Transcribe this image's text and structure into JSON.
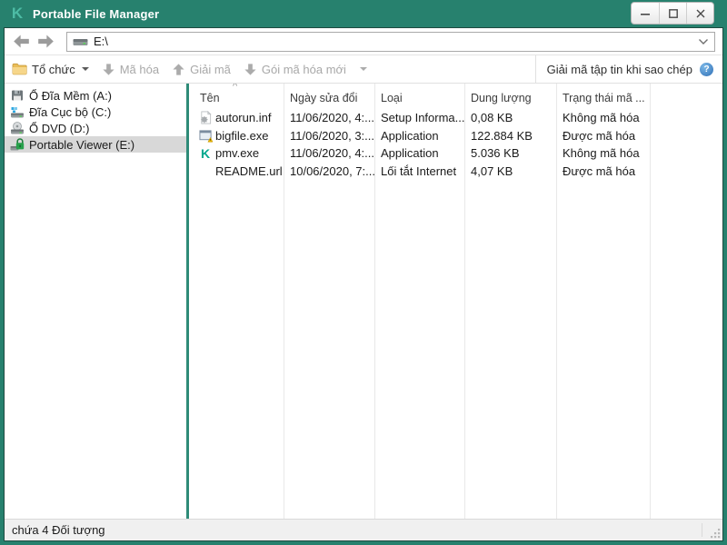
{
  "colors": {
    "titlebar_teal": "#27816E",
    "kaspersky_green": "#00A88E",
    "selection_gray": "#D8D8D8",
    "help_blue": "#3E86CC",
    "disabled_text": "#A8A8A8"
  },
  "window": {
    "title": "Portable File Manager"
  },
  "nav": {
    "address": "E:\\"
  },
  "toolbar": {
    "organize_label": "Tổ chức",
    "encrypt_label": "Mã hóa",
    "decrypt_label": "Giải mã",
    "new_package_label": "Gói mã hóa mới",
    "decrypt_on_copy_label": "Giải mã tập tin khi sao chép"
  },
  "sidebar": {
    "items": [
      {
        "label": "Ổ Đĩa Mềm (A:)",
        "icon": "floppy-drive-icon",
        "selected": false
      },
      {
        "label": "Đĩa Cục bộ (C:)",
        "icon": "local-disk-icon",
        "selected": false
      },
      {
        "label": "Ổ DVD (D:)",
        "icon": "dvd-drive-icon",
        "selected": false
      },
      {
        "label": "Portable Viewer (E:)",
        "icon": "locked-drive-icon",
        "selected": true
      }
    ]
  },
  "filelist": {
    "columns": [
      "Tên",
      "Ngày sửa đổi",
      "Loại",
      "Dung lượng",
      "Trạng thái mã ..."
    ],
    "rows": [
      {
        "name": "autorun.inf",
        "modified": "11/06/2020, 4:...",
        "type": "Setup Informa...",
        "size": "0,08 KB",
        "status": "Không mã hóa",
        "icon": "inf-file-icon"
      },
      {
        "name": "bigfile.exe",
        "modified": "11/06/2020, 3:...",
        "type": "Application",
        "size": "122.884 KB",
        "status": "Được mã hóa",
        "icon": "exe-file-icon"
      },
      {
        "name": "pmv.exe",
        "modified": "11/06/2020, 4:...",
        "type": "Application",
        "size": "5.036 KB",
        "status": "Không mã hóa",
        "icon": "kaspersky-app-icon"
      },
      {
        "name": "README.url",
        "modified": "10/06/2020, 7:...",
        "type": "Lối tắt Internet",
        "size": "4,07 KB",
        "status": "Được mã hóa",
        "icon": "none"
      }
    ]
  },
  "statusbar": {
    "text": "chứa 4 Đối tượng"
  }
}
